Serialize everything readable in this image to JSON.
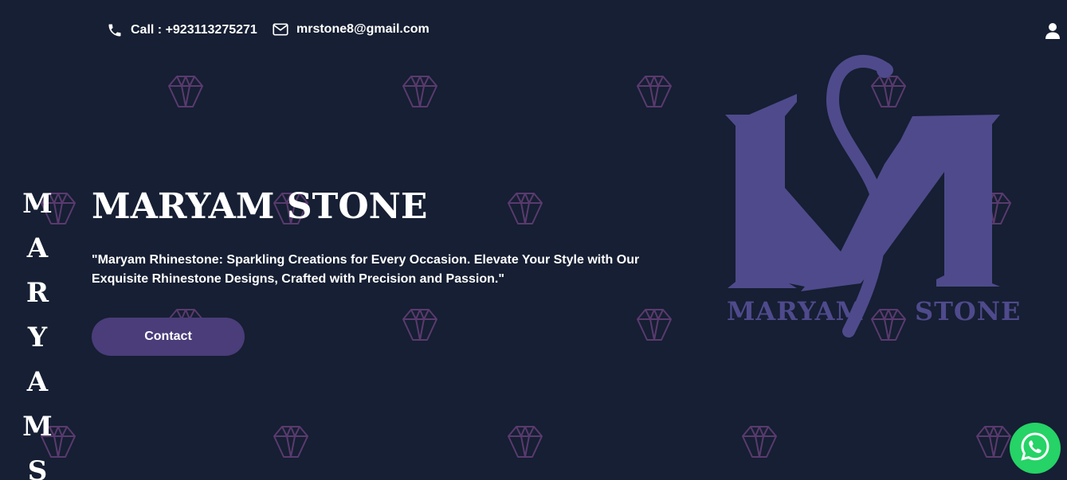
{
  "header": {
    "phone_label": "Call : +923113275271",
    "email_label": "mrstone8@gmail.com",
    "phone_icon": "phone-icon",
    "email_icon": "envelope-icon",
    "user_icon": "user-icon"
  },
  "side_text": {
    "letters": [
      "M",
      "A",
      "R",
      "Y",
      "A",
      "M",
      "S"
    ]
  },
  "hero": {
    "title": "MARYAM STONE",
    "description": "\"Maryam Rhinestone: Sparkling Creations for Every Occasion. Elevate Your Style with Our Exquisite Rhinestone Designs, Crafted with Precision and Passion.\"",
    "contact_button_label": "Contact"
  },
  "logo": {
    "word_left": "MARYAM",
    "word_right": "STONE",
    "color": "#4f4a8c"
  },
  "floating": {
    "whatsapp_icon": "whatsapp-icon"
  },
  "colors": {
    "background": "#161f33",
    "button": "#4a3d7a",
    "diamond": "#5a3a6e",
    "whatsapp": "#25d366"
  }
}
